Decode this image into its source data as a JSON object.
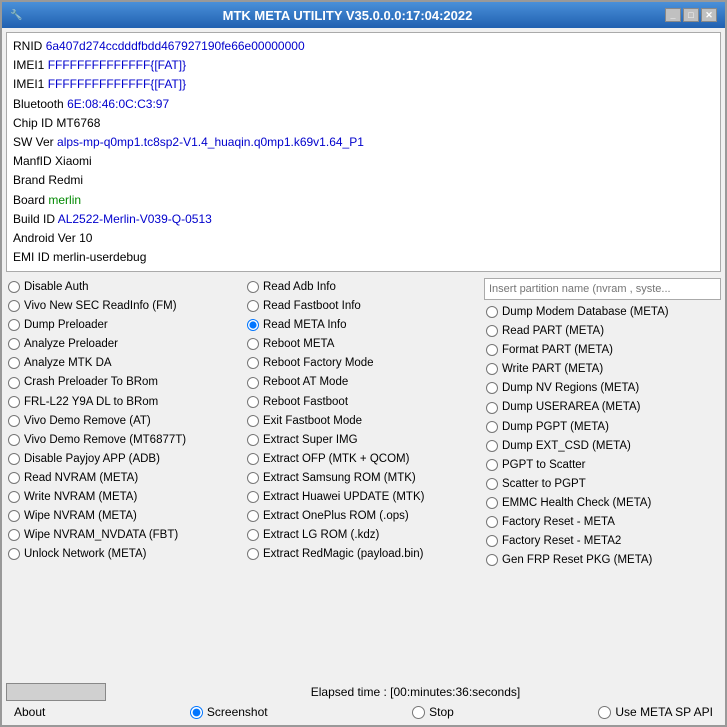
{
  "titleBar": {
    "title": "MTK META UTILITY V35.0.0.0:17:04:2022",
    "minimize": "_",
    "restore": "□",
    "close": "✕"
  },
  "info": {
    "rnid_label": "RNID",
    "rnid_value": "6a407d274ccdddfbdd467927190fe66e00000000",
    "imei1_label": "IMEI1",
    "imei1_value": "FFFFFFFFFFFFFF{[FAT]}",
    "imei2_label": "IMEI1",
    "imei2_value": "FFFFFFFFFFFFFF{[FAT]}",
    "bt_label": "Bluetooth",
    "bt_value": "6E:08:46:0C:C3:97",
    "chip_label": "Chip ID",
    "chip_value": "MT6768",
    "sw_label": "SW Ver",
    "sw_value": "alps-mp-q0mp1.tc8sp2-V1.4_huaqin.q0mp1.k69v1.64_P1",
    "manfid_label": "ManfID",
    "manfid_value": "Xiaomi",
    "brand_label": "Brand",
    "brand_value": "Redmi",
    "board_label": "Board",
    "board_value": "merlin",
    "buildid_label": "Build ID",
    "buildid_value": "AL2522-Merlin-V039-Q-0513",
    "android_label": "Android Ver",
    "android_value": "10",
    "emi_label": "EMI ID",
    "emi_value": "merlin-userdebug"
  },
  "partition_placeholder": "Insert partition name (nvram , syste...",
  "options": {
    "col1": [
      {
        "id": "disable_auth",
        "label": "Disable Auth",
        "checked": false
      },
      {
        "id": "vivo_sec",
        "label": "Vivo New SEC ReadInfo (FM)",
        "checked": false
      },
      {
        "id": "dump_preloader",
        "label": "Dump Preloader",
        "checked": false
      },
      {
        "id": "analyze_preloader",
        "label": "Analyze Preloader",
        "checked": false
      },
      {
        "id": "analyze_mtk_da",
        "label": "Analyze MTK DA",
        "checked": false
      },
      {
        "id": "crash_preloader",
        "label": "Crash Preloader To BRom",
        "checked": false
      },
      {
        "id": "frl_l22",
        "label": "FRL-L22 Y9A DL to BRom",
        "checked": false
      },
      {
        "id": "vivo_demo_at",
        "label": "Vivo Demo Remove (AT)",
        "checked": false
      },
      {
        "id": "vivo_demo_mt",
        "label": "Vivo Demo Remove (MT6877T)",
        "checked": false
      },
      {
        "id": "disable_payjoy",
        "label": "Disable Payjoy APP (ADB)",
        "checked": false
      },
      {
        "id": "read_nvram",
        "label": "Read NVRAM (META)",
        "checked": false
      },
      {
        "id": "write_nvram",
        "label": "Write NVRAM (META)",
        "checked": false
      },
      {
        "id": "wipe_nvram",
        "label": "Wipe NVRAM (META)",
        "checked": false
      },
      {
        "id": "wipe_nvram_nvdata",
        "label": "Wipe NVRAM_NVDATA (FBT)",
        "checked": false
      },
      {
        "id": "unlock_network",
        "label": "Unlock Network (META)",
        "checked": false
      }
    ],
    "col2": [
      {
        "id": "read_adb",
        "label": "Read Adb Info",
        "checked": false
      },
      {
        "id": "read_fastboot",
        "label": "Read Fastboot Info",
        "checked": false
      },
      {
        "id": "read_meta",
        "label": "Read META Info",
        "checked": true
      },
      {
        "id": "reboot_meta",
        "label": "Reboot META",
        "checked": false
      },
      {
        "id": "reboot_factory",
        "label": "Reboot Factory Mode",
        "checked": false
      },
      {
        "id": "reboot_at",
        "label": "Reboot AT Mode",
        "checked": false
      },
      {
        "id": "reboot_fastboot",
        "label": "Reboot Fastboot",
        "checked": false
      },
      {
        "id": "exit_fastboot",
        "label": "Exit Fastboot Mode",
        "checked": false
      },
      {
        "id": "extract_super",
        "label": "Extract Super IMG",
        "checked": false
      },
      {
        "id": "extract_ofp",
        "label": "Extract OFP (MTK + QCOM)",
        "checked": false
      },
      {
        "id": "extract_samsung",
        "label": "Extract Samsung ROM (MTK)",
        "checked": false
      },
      {
        "id": "extract_huawei",
        "label": "Extract Huawei UPDATE (MTK)",
        "checked": false
      },
      {
        "id": "extract_oneplus",
        "label": "Extract OnePlus ROM (.ops)",
        "checked": false
      },
      {
        "id": "extract_lg",
        "label": "Extract LG ROM (.kdz)",
        "checked": false
      },
      {
        "id": "extract_redmagic",
        "label": "Extract RedMagic (payload.bin)",
        "checked": false
      }
    ],
    "col3": [
      {
        "id": "dump_modem",
        "label": "Dump Modem Database (META)",
        "checked": false
      },
      {
        "id": "read_part_meta",
        "label": "Read PART (META)",
        "checked": false
      },
      {
        "id": "format_part",
        "label": "Format PART (META)",
        "checked": false
      },
      {
        "id": "write_part",
        "label": "Write PART (META)",
        "checked": false
      },
      {
        "id": "dump_nv_regions",
        "label": "Dump NV Regions (META)",
        "checked": false
      },
      {
        "id": "dump_userarea",
        "label": "Dump USERAREA (META)",
        "checked": false
      },
      {
        "id": "dump_pgpt",
        "label": "Dump PGPT (META)",
        "checked": false
      },
      {
        "id": "dump_ext_csd",
        "label": "Dump  EXT_CSD (META)",
        "checked": false
      },
      {
        "id": "pgpt_scatter",
        "label": "PGPT to Scatter",
        "checked": false
      },
      {
        "id": "scatter_pgpt",
        "label": "Scatter to PGPT",
        "checked": false
      },
      {
        "id": "emmc_health",
        "label": "EMMC Health Check (META)",
        "checked": false
      },
      {
        "id": "factory_reset",
        "label": "Factory Reset - META",
        "checked": false
      },
      {
        "id": "factory_reset2",
        "label": "Factory Reset - META2",
        "checked": false
      },
      {
        "id": "gen_frp",
        "label": "Gen FRP Reset PKG (META)",
        "checked": false
      }
    ]
  },
  "bottomBar": {
    "elapsed_label": "Elapsed time : [00:minutes:36:seconds]",
    "about_label": "About",
    "screenshot_label": "Screenshot",
    "stop_label": "Stop",
    "use_meta_label": "Use META SP API"
  }
}
